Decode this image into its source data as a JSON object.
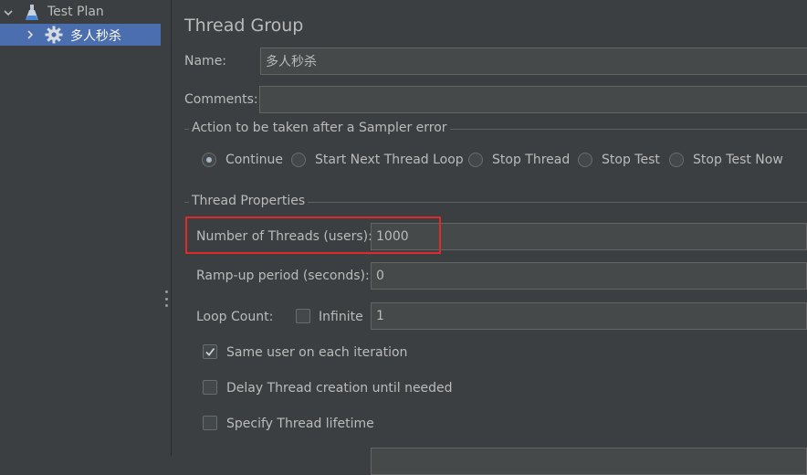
{
  "tree": {
    "items": [
      {
        "label": "Test Plan",
        "icon": "test-plan-flask-icon",
        "expanded": true
      },
      {
        "label": "多人秒杀",
        "icon": "gear-icon",
        "expanded": false,
        "selected": true
      }
    ]
  },
  "panel": {
    "title": "Thread Group",
    "name_label": "Name:",
    "name_value": "多人秒杀",
    "comments_label": "Comments:",
    "comments_value": "",
    "sampler_error": {
      "title": "Action to be taken after a Sampler error",
      "options": [
        "Continue",
        "Start Next Thread Loop",
        "Stop Thread",
        "Stop Test",
        "Stop Test Now"
      ],
      "selected": "Continue"
    },
    "thread_props": {
      "title": "Thread Properties",
      "num_threads_label": "Number of Threads (users):",
      "num_threads_value": "1000",
      "ramp_up_label": "Ramp-up period (seconds):",
      "ramp_up_value": "0",
      "loop_count_label": "Loop Count:",
      "infinite_label": "Infinite",
      "infinite_checked": false,
      "loop_count_value": "1",
      "same_user_label": "Same user on each iteration",
      "same_user_checked": true,
      "delay_label": "Delay Thread creation until needed",
      "delay_checked": false,
      "lifetime_label": "Specify Thread lifetime",
      "lifetime_checked": false
    }
  },
  "colors": {
    "background": "#3c3f41",
    "selection": "#4b6eaf",
    "field": "#45494a",
    "highlight": "#e02a2a"
  }
}
